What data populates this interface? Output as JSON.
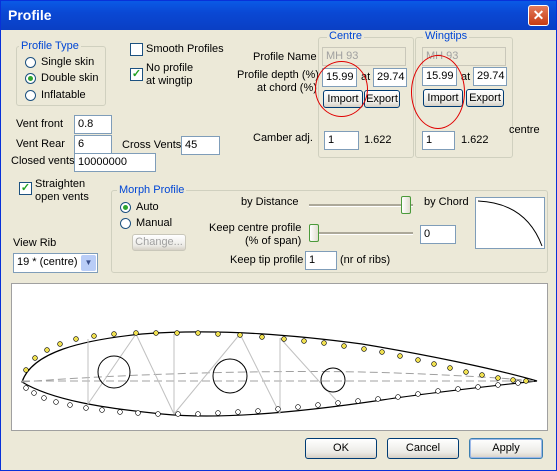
{
  "window": {
    "title": "Profile",
    "close_glyph": "✕"
  },
  "profile_type": {
    "legend": "Profile Type",
    "options": [
      {
        "label": "Single skin",
        "selected": false
      },
      {
        "label": "Double skin",
        "selected": true
      },
      {
        "label": "Inflatable",
        "selected": false
      }
    ]
  },
  "smooth_profiles": {
    "label": "Smooth Profiles",
    "checked": false
  },
  "no_profile_wingtip": {
    "label_line1": "No profile",
    "label_line2": "at wingtip",
    "checked": true
  },
  "labels": {
    "profile_name": "Profile Name",
    "profile_depth_line1": "Profile depth (%)",
    "profile_depth_line2": "at chord (%)",
    "at": "at",
    "camber_adj": "Camber adj.",
    "centre_side": "centre"
  },
  "centre": {
    "legend": "Centre",
    "profile_name": "MH 93",
    "depth": "15.99",
    "chord": "29.74",
    "import_label": "Import",
    "export_label": "Export",
    "camber": "1",
    "camber_value": "1.622"
  },
  "wingtips": {
    "legend": "Wingtips",
    "profile_name": "MH 93",
    "depth": "15.99",
    "chord": "29.74",
    "import_label": "Import",
    "export_label": "Export",
    "camber": "1",
    "camber_value": "1.622"
  },
  "vents": {
    "vent_front_label": "Vent front",
    "vent_front": "0.8",
    "vent_rear_label": "Vent Rear",
    "vent_rear": "6",
    "cross_vents_label": "Cross Vents",
    "cross_vents": "45",
    "closed_vents_label": "Closed vents",
    "closed_vents": "10000000"
  },
  "straighten": {
    "label_line1": "Straighten",
    "label_line2": "open vents",
    "checked": true
  },
  "morph": {
    "legend": "Morph Profile",
    "auto_label": "Auto",
    "manual_label": "Manual",
    "change_label": "Change...",
    "by_distance": "by Distance",
    "by_chord": "by Chord",
    "keep_centre_line1": "Keep centre profile",
    "keep_centre_line2": "(% of span)",
    "keep_centre_value": "0",
    "keep_tip_label": "Keep tip profile",
    "keep_tip_value": "1",
    "keep_tip_unit": "(nr of ribs)",
    "slider1_level": 0.98,
    "slider2_level": 0.0
  },
  "view_rib": {
    "label": "View Rib",
    "value": "19 * (centre)"
  },
  "buttons": {
    "ok": "OK",
    "cancel": "Cancel",
    "apply": "Apply"
  },
  "colors": {
    "titlebar": "#0a48d4",
    "annotation": "#e00000",
    "dot": "#f0e050",
    "selected_radio": "#2fa52f"
  }
}
